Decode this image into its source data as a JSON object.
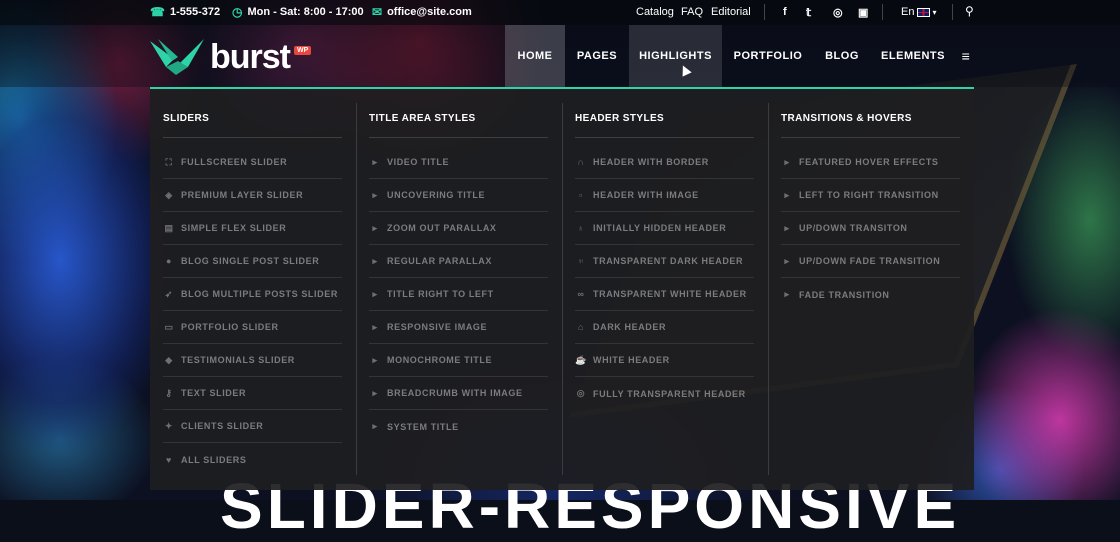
{
  "topbar": {
    "phone": "1-555-372",
    "hours": "Mon - Sat: 8:00 - 17:00",
    "email": "office@site.com",
    "links": [
      "Catalog",
      "FAQ",
      "Editorial"
    ],
    "social_icons": [
      "facebook-icon",
      "twitter-icon",
      "dribbble-icon",
      "instagram-icon"
    ],
    "language": "En"
  },
  "header": {
    "logo_text": "burst",
    "logo_badge": "WP",
    "nav": [
      "HOME",
      "PAGES",
      "HIGHLIGHTS",
      "PORTFOLIO",
      "BLOG",
      "ELEMENTS"
    ]
  },
  "mega_menu": {
    "columns": [
      {
        "title": "SLIDERS",
        "items": [
          {
            "label": "FULLSCREEN SLIDER",
            "icon": "fullscreen-icon"
          },
          {
            "label": "PREMIUM LAYER SLIDER",
            "icon": "layers-icon"
          },
          {
            "label": "SIMPLE FLEX SLIDER",
            "icon": "film-icon"
          },
          {
            "label": "BLOG SINGLE POST SLIDER",
            "icon": "circle-icon"
          },
          {
            "label": "BLOG MULTIPLE POSTS SLIDER",
            "icon": "rocket-icon"
          },
          {
            "label": "PORTFOLIO SLIDER",
            "icon": "card-icon"
          },
          {
            "label": "TESTIMONIALS SLIDER",
            "icon": "tag-icon"
          },
          {
            "label": "TEXT SLIDER",
            "icon": "key-icon"
          },
          {
            "label": "CLIENTS SLIDER",
            "icon": "pin-icon"
          },
          {
            "label": "ALL SLIDERS",
            "icon": "heart-icon"
          }
        ]
      },
      {
        "title": "TITLE AREA STYLES",
        "items": [
          {
            "label": "VIDEO TITLE",
            "icon": "caret-right-icon"
          },
          {
            "label": "UNCOVERING TITLE",
            "icon": "caret-right-icon"
          },
          {
            "label": "ZOOM OUT PARALLAX",
            "icon": "caret-right-icon"
          },
          {
            "label": "REGULAR PARALLAX",
            "icon": "caret-right-icon"
          },
          {
            "label": "TITLE RIGHT TO LEFT",
            "icon": "caret-right-icon"
          },
          {
            "label": "RESPONSIVE IMAGE",
            "icon": "caret-right-icon"
          },
          {
            "label": "MONOCHROME TITLE",
            "icon": "caret-right-icon"
          },
          {
            "label": "BREADCRUMB WITH IMAGE",
            "icon": "caret-right-icon"
          },
          {
            "label": "SYSTEM TITLE",
            "icon": "caret-right-icon"
          }
        ]
      },
      {
        "title": "HEADER STYLES",
        "items": [
          {
            "label": "HEADER WITH BORDER",
            "icon": "headphones-icon"
          },
          {
            "label": "HEADER WITH IMAGE",
            "icon": "lock-icon"
          },
          {
            "label": "INITIALLY HIDDEN HEADER",
            "icon": "bulb-icon"
          },
          {
            "label": "TRANSPARENT DARK HEADER",
            "icon": "trophy-icon"
          },
          {
            "label": "TRANSPARENT WHITE HEADER",
            "icon": "glasses-icon"
          },
          {
            "label": "DARK HEADER",
            "icon": "car-icon"
          },
          {
            "label": "WHITE HEADER",
            "icon": "mug-icon"
          },
          {
            "label": "FULLY TRANSPARENT HEADER",
            "icon": "coins-icon"
          }
        ]
      },
      {
        "title": "TRANSITIONS & HOVERS",
        "items": [
          {
            "label": "FEATURED HOVER EFFECTS",
            "icon": "caret-right-icon"
          },
          {
            "label": "LEFT TO RIGHT TRANSITION",
            "icon": "caret-right-icon"
          },
          {
            "label": "UP/DOWN TRANSITON",
            "icon": "caret-right-icon"
          },
          {
            "label": "UP/DOWN FADE TRANSITION",
            "icon": "caret-right-icon"
          },
          {
            "label": "FADE TRANSITION",
            "icon": "caret-right-icon"
          }
        ]
      }
    ]
  },
  "hero_heading": "SLIDER-RESPONSIVE",
  "colors": {
    "accent": "#2ed3a8",
    "badge": "#e8473c",
    "menu_bg": "#1e1e20",
    "item_text": "#7c7c80"
  }
}
